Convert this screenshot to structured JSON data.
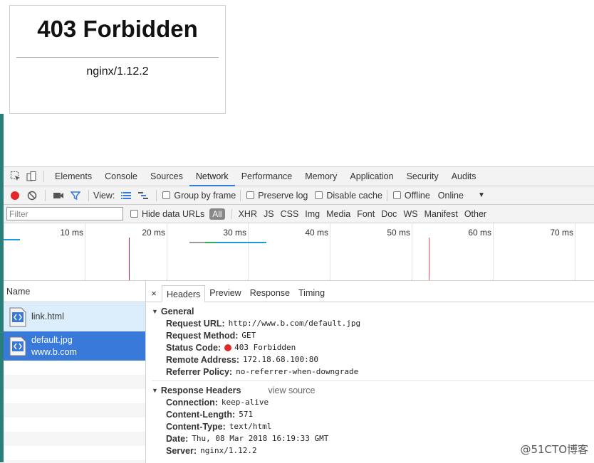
{
  "page": {
    "heading": "403 Forbidden",
    "server_line": "nginx/1.12.2"
  },
  "devtools": {
    "panel_tabs": [
      "Elements",
      "Console",
      "Sources",
      "Network",
      "Performance",
      "Memory",
      "Application",
      "Security",
      "Audits"
    ],
    "toolbar": {
      "view_label": "View:",
      "group_by_frame": "Group by frame",
      "preserve_log": "Preserve log",
      "disable_cache": "Disable cache",
      "offline": "Offline",
      "throttle": "Online"
    },
    "filter": {
      "placeholder": "Filter",
      "hide_data_urls": "Hide data URLs",
      "types": [
        "All",
        "XHR",
        "JS",
        "CSS",
        "Img",
        "Media",
        "Font",
        "Doc",
        "WS",
        "Manifest",
        "Other"
      ]
    },
    "timeline": {
      "ticks": [
        "10 ms",
        "20 ms",
        "30 ms",
        "40 ms",
        "50 ms",
        "60 ms",
        "70 ms"
      ]
    },
    "requests": {
      "header": "Name",
      "items": [
        {
          "name": "link.html",
          "domain": ""
        },
        {
          "name": "default.jpg",
          "domain": "www.b.com"
        }
      ]
    },
    "details": {
      "close": "×",
      "tabs": [
        "Headers",
        "Preview",
        "Response",
        "Timing"
      ],
      "general": {
        "title": "General",
        "rows": [
          {
            "key": "Request URL:",
            "value": "http://www.b.com/default.jpg"
          },
          {
            "key": "Request Method:",
            "value": "GET"
          },
          {
            "key": "Status Code:",
            "value": "403 Forbidden"
          },
          {
            "key": "Remote Address:",
            "value": "172.18.68.100:80"
          },
          {
            "key": "Referrer Policy:",
            "value": "no-referrer-when-downgrade"
          }
        ]
      },
      "response_headers": {
        "title": "Response Headers",
        "view_source": "view source",
        "rows": [
          {
            "key": "Connection:",
            "value": "keep-alive"
          },
          {
            "key": "Content-Length:",
            "value": "571"
          },
          {
            "key": "Content-Type:",
            "value": "text/html"
          },
          {
            "key": "Date:",
            "value": "Thu, 08 Mar 2018 16:19:33 GMT"
          },
          {
            "key": "Server:",
            "value": "nginx/1.12.2"
          }
        ]
      }
    }
  },
  "watermark": "@51CTO博客",
  "colors": {
    "active_tab": "#3879d9",
    "record": "#e12828",
    "status_error": "#e12828",
    "selected_row": "#3879d9"
  }
}
